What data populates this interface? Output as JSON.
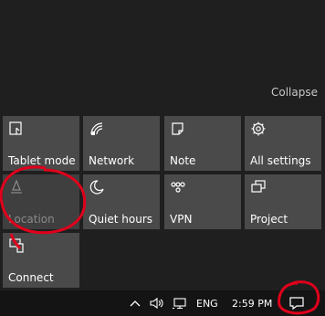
{
  "action_center": {
    "collapse_label": "Collapse",
    "tiles": [
      {
        "label": "Tablet mode",
        "icon": "tablet-mode-icon",
        "enabled": true
      },
      {
        "label": "Network",
        "icon": "network-icon",
        "enabled": true
      },
      {
        "label": "Note",
        "icon": "note-icon",
        "enabled": true
      },
      {
        "label": "All settings",
        "icon": "gear-icon",
        "enabled": true
      },
      {
        "label": "Location",
        "icon": "location-icon",
        "enabled": false
      },
      {
        "label": "Quiet hours",
        "icon": "moon-icon",
        "enabled": true
      },
      {
        "label": "VPN",
        "icon": "vpn-icon",
        "enabled": true
      },
      {
        "label": "Project",
        "icon": "project-icon",
        "enabled": true
      },
      {
        "label": "Connect",
        "icon": "connect-icon",
        "enabled": true
      }
    ]
  },
  "taskbar": {
    "language": "ENG",
    "time": "2:59 PM",
    "icons": [
      "chevron-up-icon",
      "volume-icon",
      "network-monitor-icon",
      "action-center-icon"
    ]
  },
  "colors": {
    "panel_bg": "#1f1f1f",
    "tile_bg": "#4a4a4a",
    "annotation_red": "#e0001b"
  }
}
